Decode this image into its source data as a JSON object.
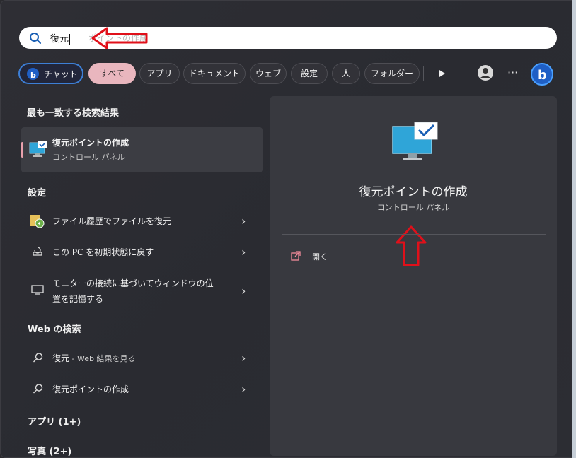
{
  "search": {
    "query": "復元",
    "suggestion": "ポイントの作成"
  },
  "chips": [
    {
      "label": "チャット",
      "name": "chip-chat"
    },
    {
      "label": "すべて",
      "name": "chip-all"
    },
    {
      "label": "アプリ",
      "name": "chip-apps"
    },
    {
      "label": "ドキュメント",
      "name": "chip-documents"
    },
    {
      "label": "ウェブ",
      "name": "chip-web"
    },
    {
      "label": "設定",
      "name": "chip-settings"
    },
    {
      "label": "人",
      "name": "chip-people"
    },
    {
      "label": "フォルダー",
      "name": "chip-folders"
    }
  ],
  "toolbar": {
    "more_label": "···"
  },
  "sections": {
    "best_match": "最も一致する検索結果",
    "settings": "設定",
    "web": "Web の検索",
    "apps": "アプリ (1+)",
    "photos": "写真 (2+)"
  },
  "best_match": {
    "title": "復元ポイントの作成",
    "subtitle": "コントロール パネル"
  },
  "settings_items": [
    {
      "label": "ファイル履歴でファイルを復元"
    },
    {
      "label": "この PC を初期状態に戻す"
    },
    {
      "label_line1": "モニターの接続に基づいてウィンドウの位",
      "label_line2": "置を記憶する"
    }
  ],
  "web_items": [
    {
      "label": "復元",
      "suffix": " - Web 結果を見る"
    },
    {
      "label": "復元ポイントの作成"
    }
  ],
  "preview": {
    "title": "復元ポイントの作成",
    "subtitle": "コントロール パネル",
    "open_label": "開く"
  },
  "colors": {
    "accent_blue": "#3d7fd6",
    "selected_chip": "#e9b6be",
    "annotation_red": "#e0101a"
  }
}
